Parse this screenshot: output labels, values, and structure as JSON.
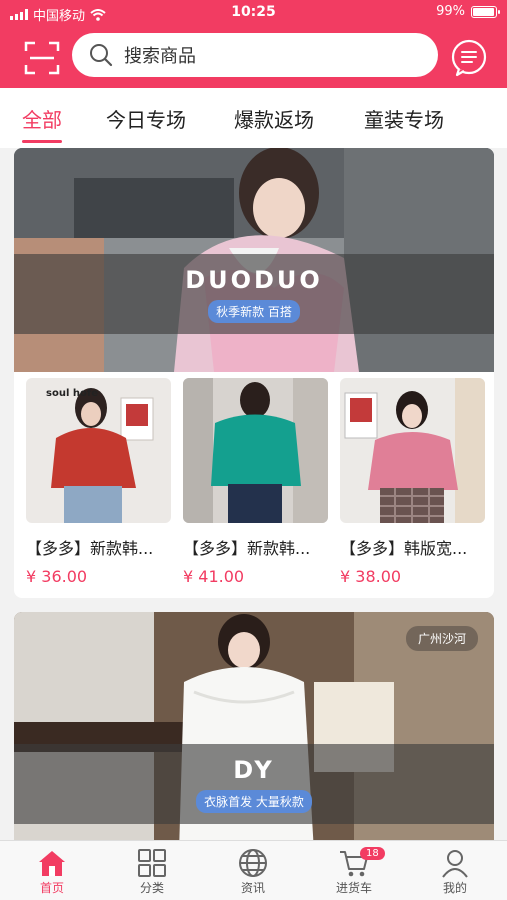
{
  "status": {
    "carrier": "中国移动",
    "time": "10:25",
    "battery": "99%"
  },
  "header": {
    "search_placeholder": "搜索商品"
  },
  "tabs": [
    {
      "label": "全部",
      "active": true
    },
    {
      "label": "今日专场",
      "active": false
    },
    {
      "label": "爆款返场",
      "active": false
    },
    {
      "label": "童装专场",
      "active": false
    }
  ],
  "shops": [
    {
      "name": "DUODUO",
      "tag": "秋季新款 百搭",
      "location": "",
      "products": [
        {
          "title": "【多多】新款韩...",
          "price": "¥ 36.00"
        },
        {
          "title": "【多多】新款韩...",
          "price": "¥ 41.00"
        },
        {
          "title": "【多多】韩版宽...",
          "price": "¥ 38.00"
        }
      ]
    },
    {
      "name": "DY",
      "tag": "衣脉首发 大量秋款",
      "location": "广州沙河"
    }
  ],
  "product_image_text": "soul hofe",
  "nav": [
    {
      "label": "首页",
      "icon": "home-icon",
      "active": true
    },
    {
      "label": "分类",
      "icon": "grid-icon",
      "active": false
    },
    {
      "label": "资讯",
      "icon": "globe-icon",
      "active": false
    },
    {
      "label": "进货车",
      "icon": "cart-icon",
      "active": false,
      "badge": "18"
    },
    {
      "label": "我的",
      "icon": "user-icon",
      "active": false
    }
  ],
  "colors": {
    "accent": "#f23c62",
    "tag_blue": "#5b8ad8"
  }
}
